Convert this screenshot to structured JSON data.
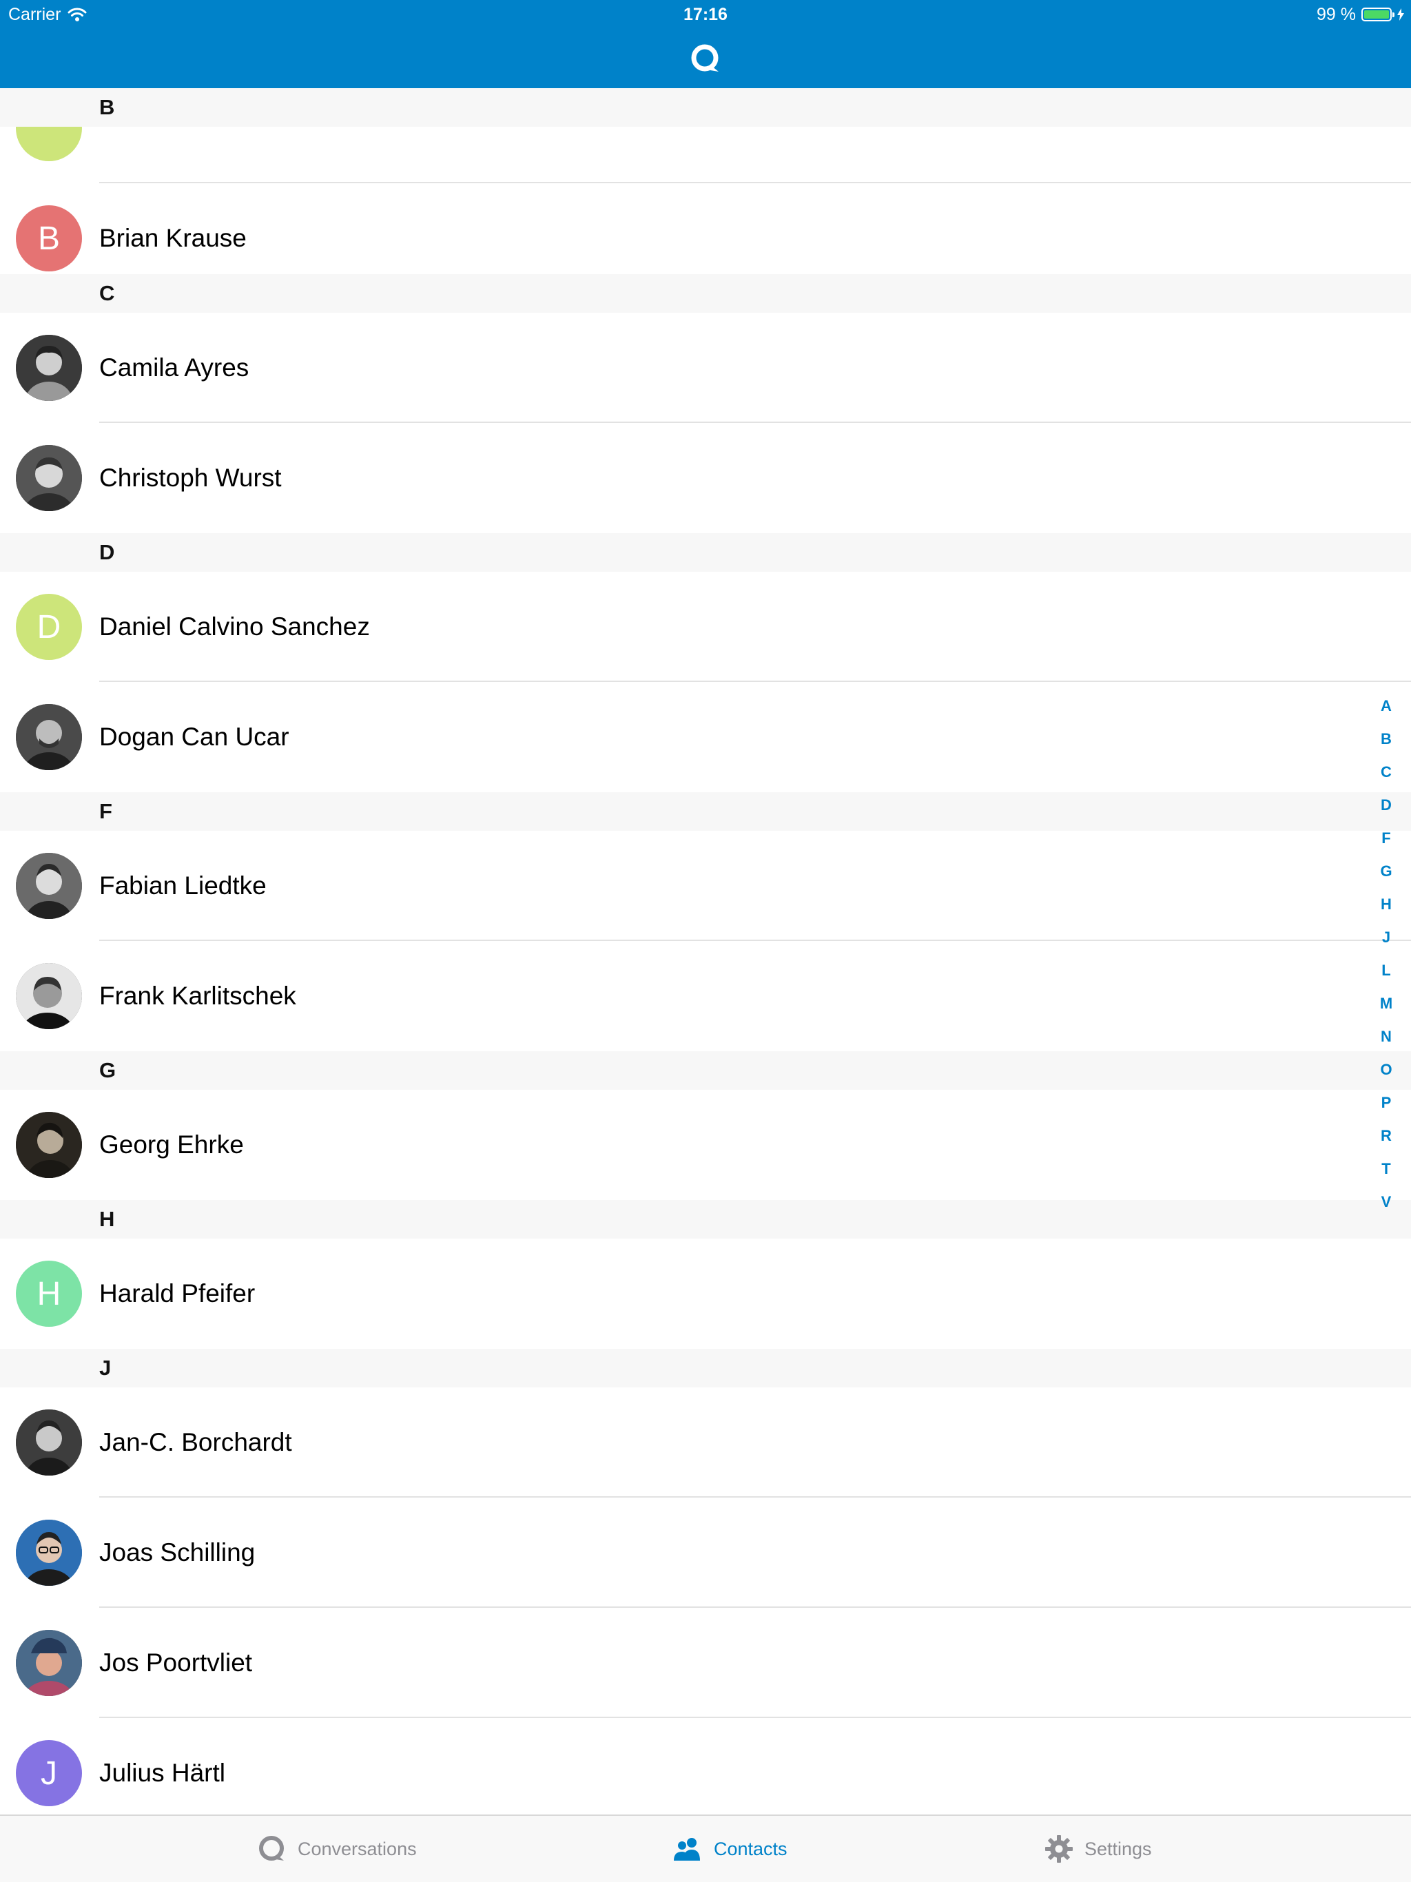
{
  "status_bar": {
    "carrier": "Carrier",
    "time": "17:16",
    "battery": "99 %",
    "battery_level": 0.99
  },
  "nav": {
    "logo_icon": "talk-logo-icon"
  },
  "colors": {
    "brand": "#0082c9",
    "header_bg": "#f7f7f7",
    "separator": "#e2e2e2",
    "tab_inactive": "#8e8e93"
  },
  "contacts": {
    "sections": [
      {
        "letter": "B"
      },
      {
        "letter": "C"
      },
      {
        "letter": "D"
      },
      {
        "letter": "F"
      },
      {
        "letter": "G"
      },
      {
        "letter": "H"
      },
      {
        "letter": "J"
      }
    ],
    "rows": [
      {
        "name": "Brian Krause",
        "initial": "B",
        "avatar_color": "#e57373"
      },
      {
        "name": "Camila Ayres",
        "avatar_icon": "user-photo-icon"
      },
      {
        "name": "Christoph Wurst",
        "avatar_icon": "user-photo-icon"
      },
      {
        "name": "Daniel Calvino Sanchez",
        "initial": "D",
        "avatar_color": "#cde57a"
      },
      {
        "name": "Dogan Can Ucar",
        "avatar_icon": "user-photo-icon"
      },
      {
        "name": "Fabian Liedtke",
        "avatar_icon": "user-photo-icon"
      },
      {
        "name": "Frank Karlitschek",
        "avatar_icon": "user-photo-icon"
      },
      {
        "name": "Georg Ehrke",
        "avatar_icon": "user-photo-icon"
      },
      {
        "name": "Harald Pfeifer",
        "initial": "H",
        "avatar_color": "#7de3a6"
      },
      {
        "name": "Jan-C. Borchardt",
        "avatar_icon": "user-photo-icon"
      },
      {
        "name": "Joas Schilling",
        "avatar_icon": "user-photo-icon"
      },
      {
        "name": "Jos Poortvliet",
        "avatar_icon": "user-photo-icon"
      },
      {
        "name": "Julius Härtl",
        "initial": "J",
        "avatar_color": "#8573e3"
      }
    ]
  },
  "index": [
    "A",
    "B",
    "C",
    "D",
    "F",
    "G",
    "H",
    "J",
    "L",
    "M",
    "N",
    "O",
    "P",
    "R",
    "T",
    "V"
  ],
  "tabbar": {
    "conversations_label": "Conversations",
    "contacts_label": "Contacts",
    "settings_label": "Settings",
    "active": "contacts"
  }
}
